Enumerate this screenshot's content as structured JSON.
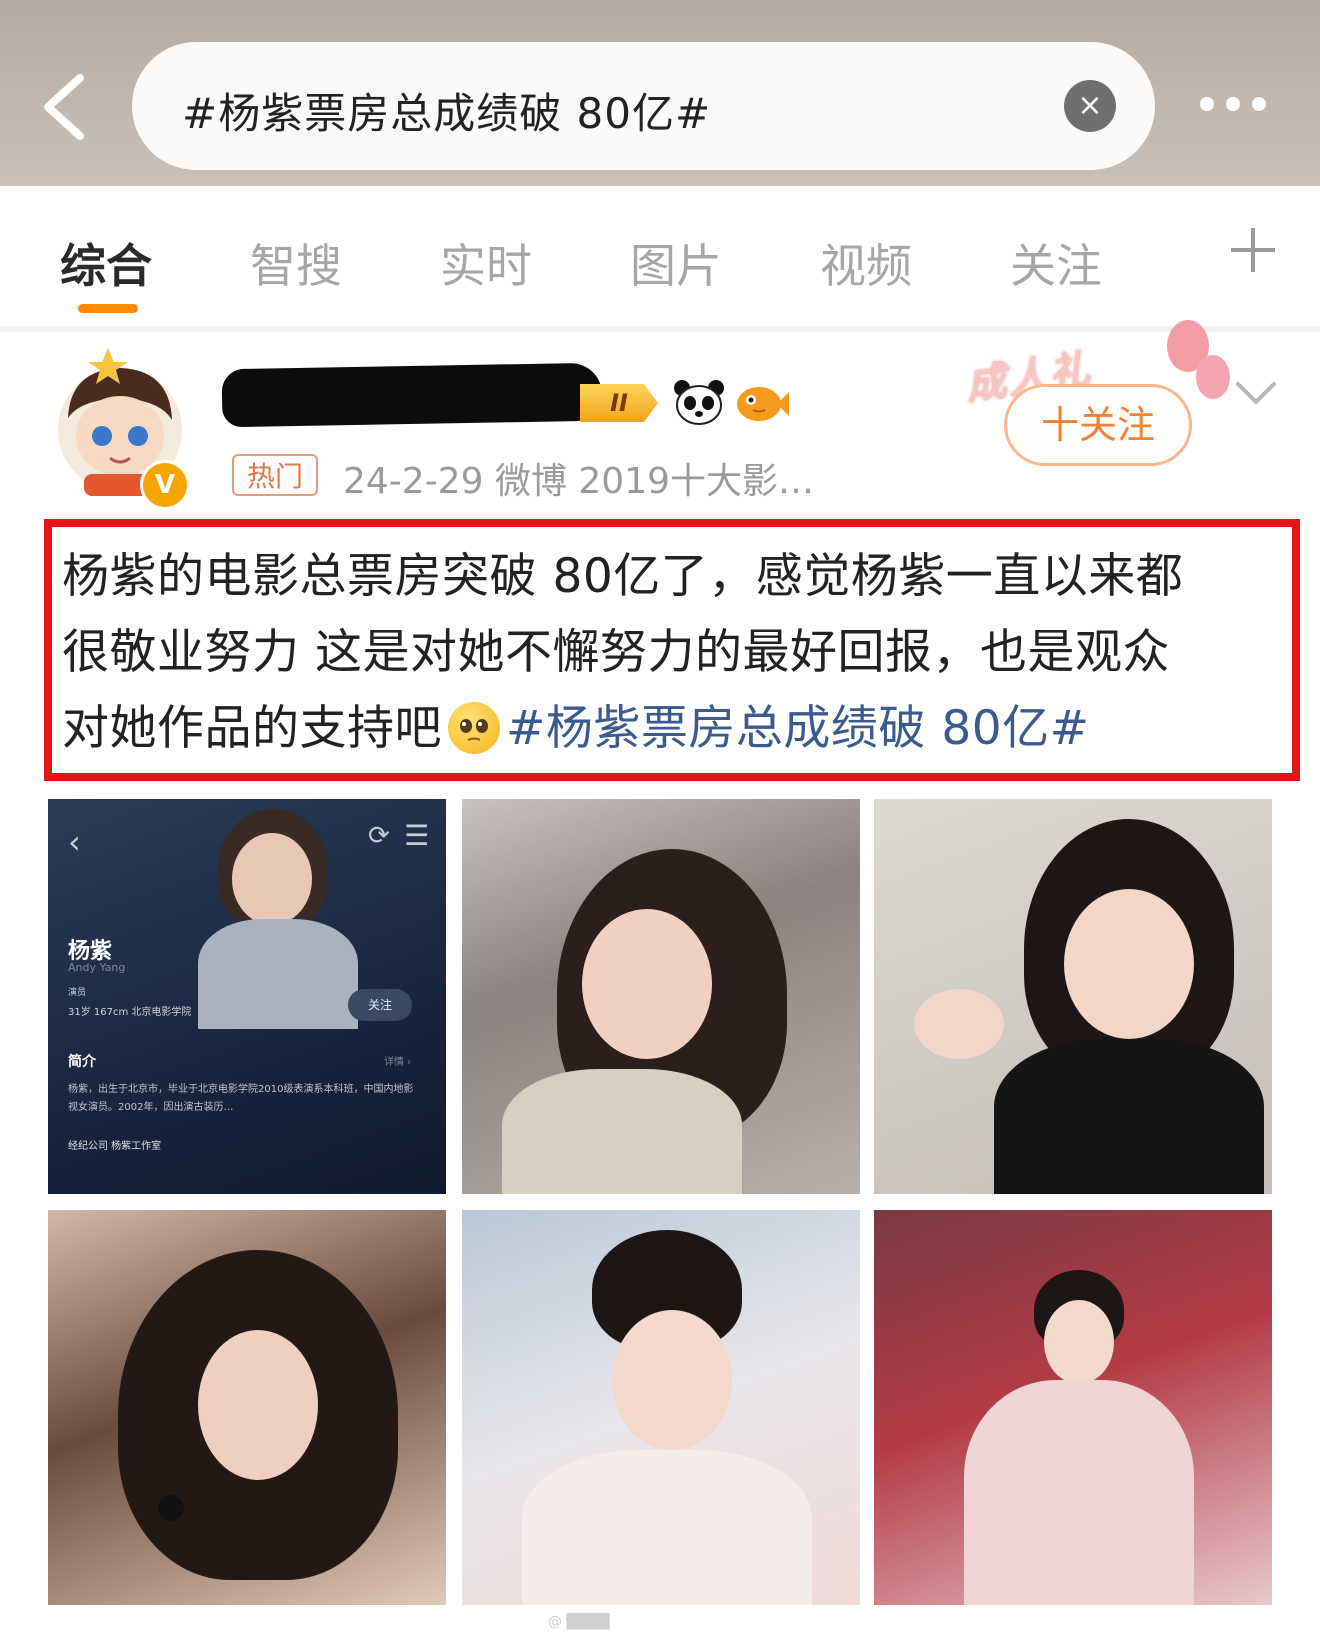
{
  "search": {
    "query": "#杨紫票房总成绩破 80亿#",
    "clear_label": "×"
  },
  "tabs": [
    {
      "label": "综合",
      "active": true
    },
    {
      "label": "智搜",
      "active": false
    },
    {
      "label": "实时",
      "active": false
    },
    {
      "label": "图片",
      "active": false
    },
    {
      "label": "视频",
      "active": false
    },
    {
      "label": "关注",
      "active": false
    }
  ],
  "post": {
    "user_level_badge": "II",
    "verified_mark": "V",
    "hot_tag": "热门",
    "meta": "24-2-29  微博 2019十大影…",
    "ceremony_decoration": "成人礼",
    "follow_label": "十关注",
    "text_lines": [
      "杨紫的电影总票房突破 80亿了，感觉杨紫一直以来都",
      "很敬业努力 这是对她不懈努力的最好回报，也是观众",
      "对她作品的支持吧"
    ],
    "hashtag": "#杨紫票房总成绩破 80亿#"
  },
  "profile_screenshot": {
    "back": "‹",
    "name": "杨紫",
    "english_name": "Andy Yang",
    "role": "演员",
    "stats": "31岁   167cm   北京电影学院",
    "follow": "关注",
    "intro_title": "简介",
    "detail_link": "详情 ›",
    "bio": "杨紫，出生于北京市，毕业于北京电影学院2010级表演系本科班，中国内地影视女演员。2002年，因出演古装历…",
    "agency": "经纪公司   杨紫工作室"
  },
  "colors": {
    "accent_orange": "#ff8a00",
    "highlight_box": "#e8141a",
    "hashtag_blue": "#3b5b8f",
    "follow_orange": "#f28235"
  }
}
